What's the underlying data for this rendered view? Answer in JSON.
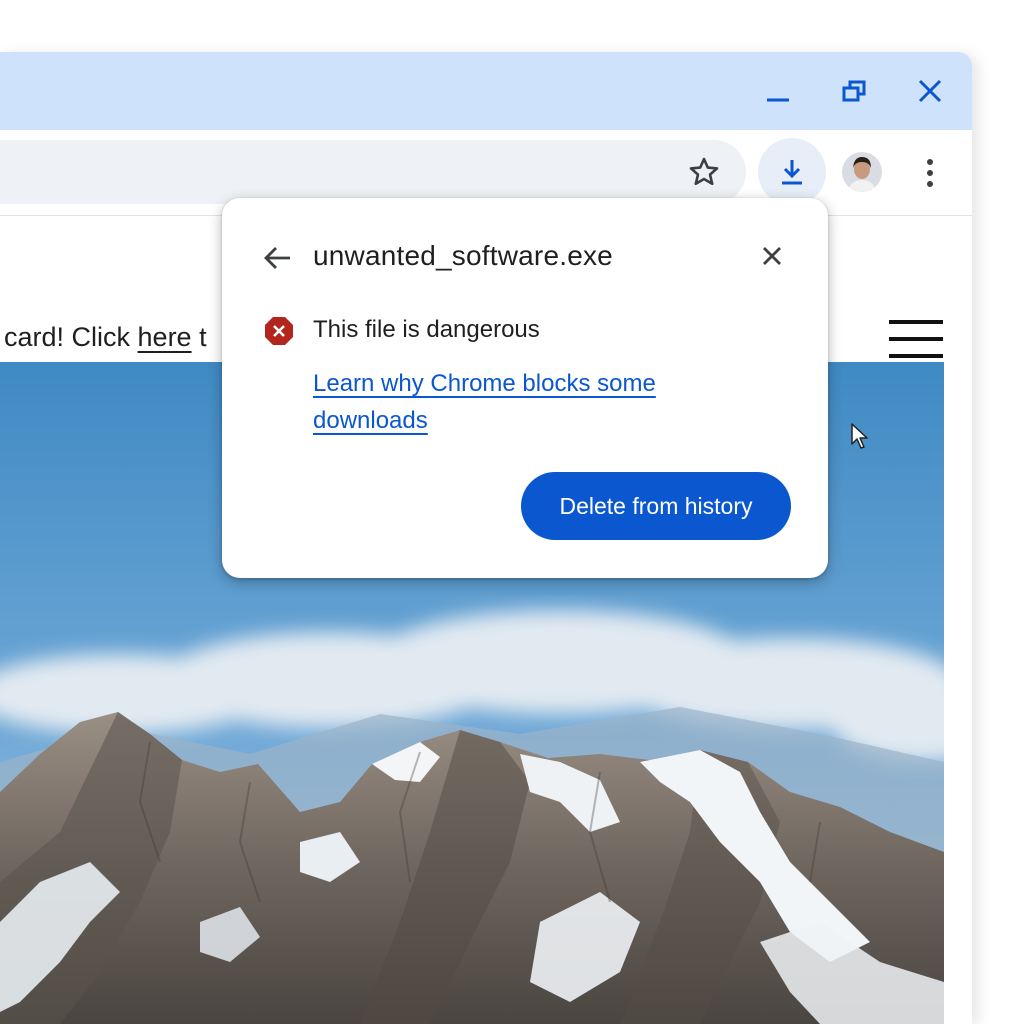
{
  "popup": {
    "title": "unwanted_software.exe",
    "warning": "This file is dangerous",
    "learn_link": "Learn why Chrome blocks some downloads",
    "delete_button": "Delete from history"
  },
  "page": {
    "text_before": "card! Click ",
    "link": "here",
    "text_after": " t"
  },
  "icons": {
    "minimize": "minimize-icon",
    "restore": "restore-icon",
    "close_window": "close-icon",
    "bookmark": "star-icon",
    "download": "download-icon",
    "menu": "kebab-menu-icon",
    "back": "arrow-left-icon",
    "close_popup": "close-icon",
    "danger": "error-circle-icon",
    "hamburger": "hamburger-menu-icon"
  },
  "colors": {
    "titlebar": "#cfe2fc",
    "accent": "#0b57d0",
    "danger": "#b3261e",
    "omnibox": "#eef1f6"
  }
}
